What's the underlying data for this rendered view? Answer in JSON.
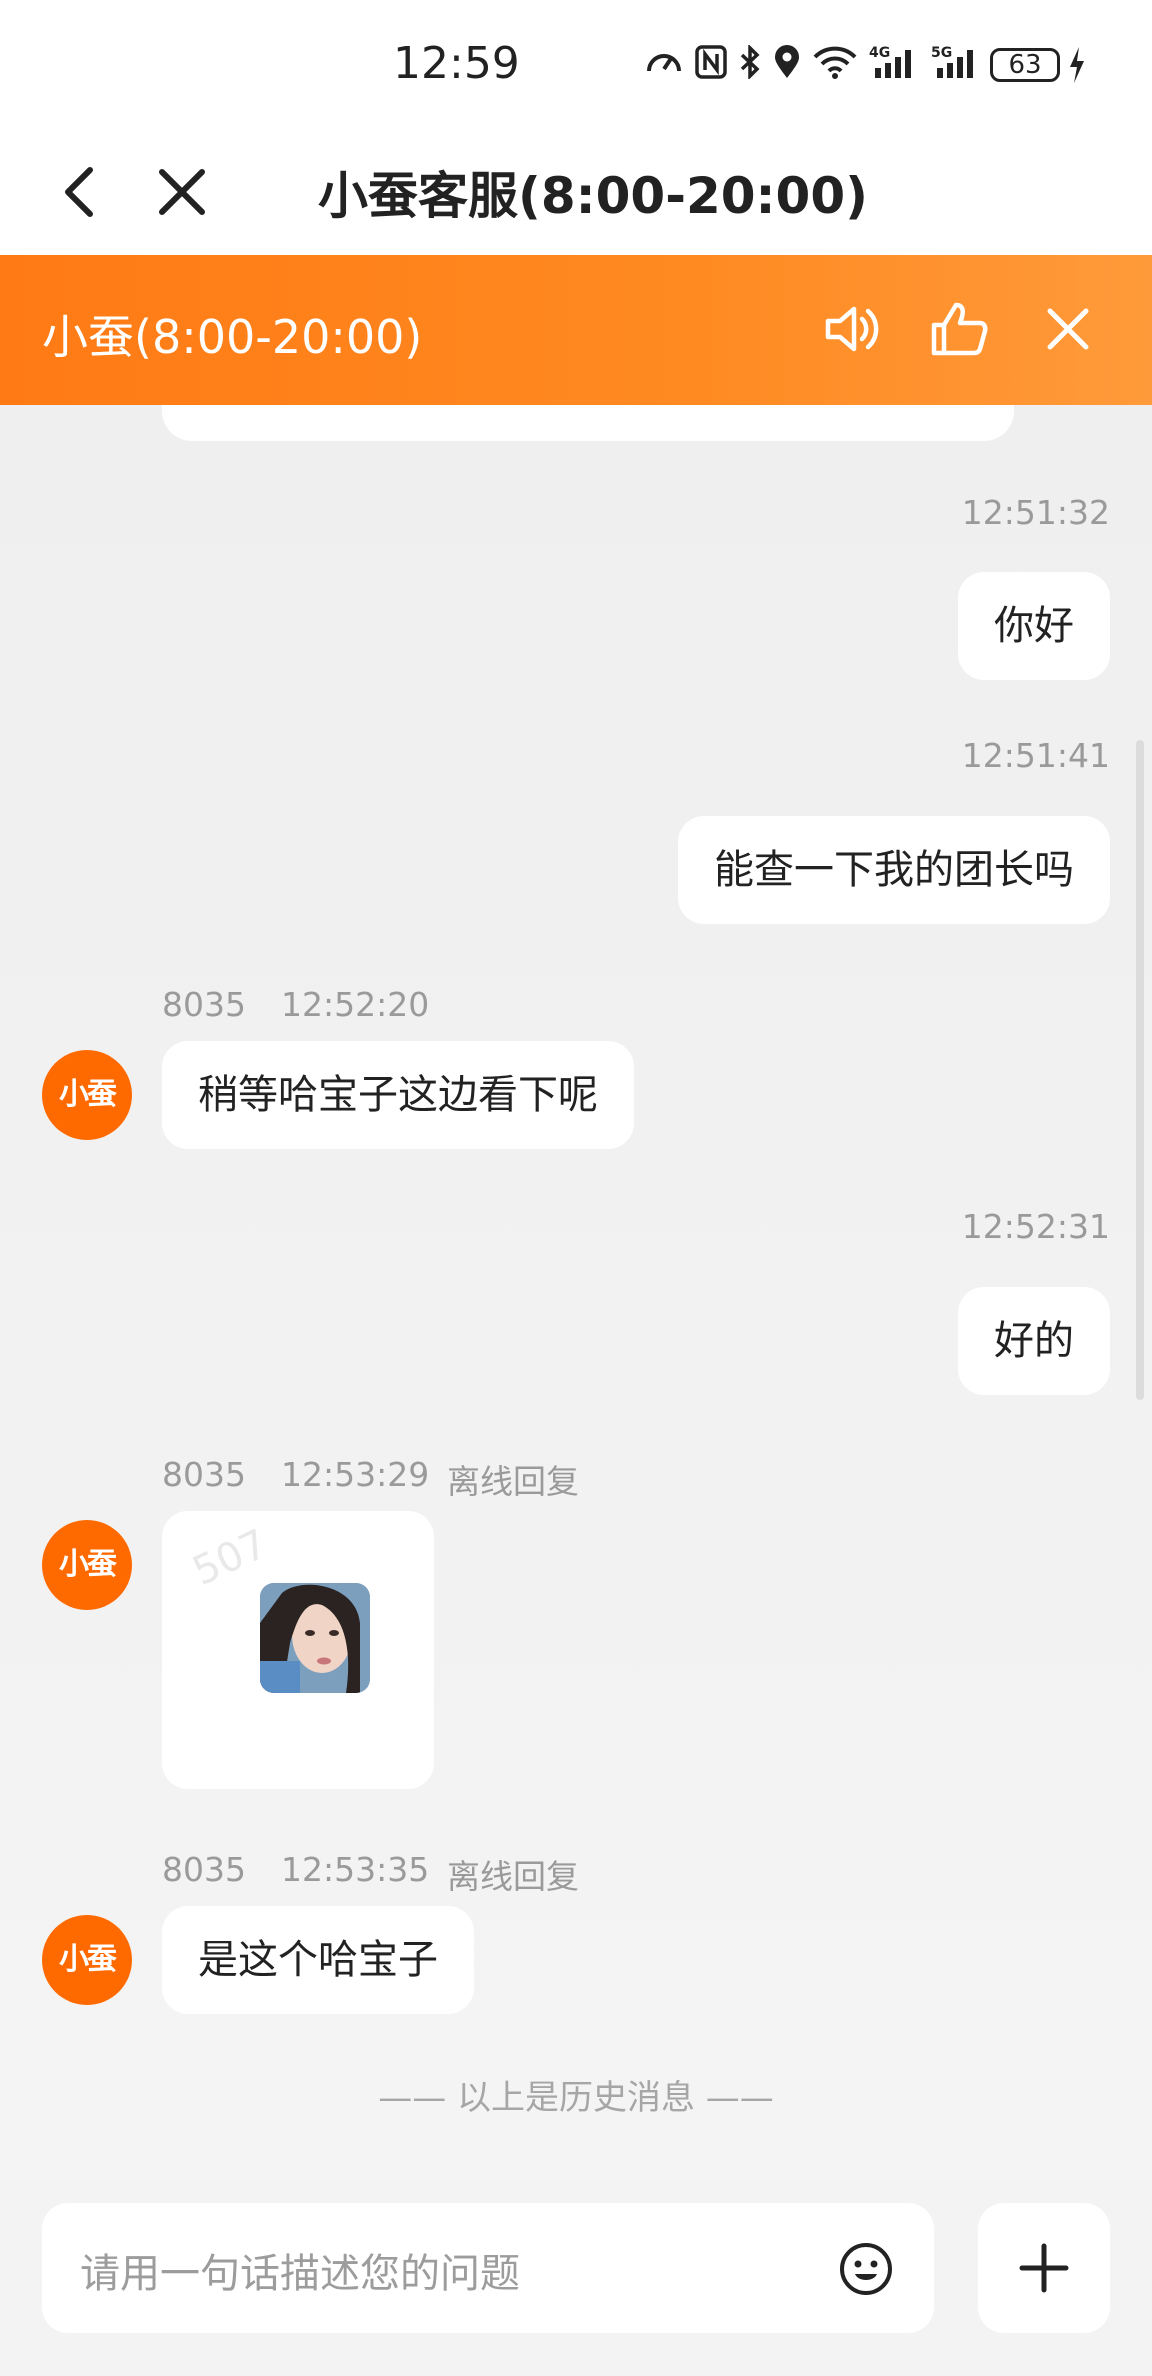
{
  "status_bar": {
    "time": "12:59",
    "battery": "63",
    "network_labels": [
      "4G",
      "5G"
    ]
  },
  "nav": {
    "title": "小蚕客服(8:00-20:00)"
  },
  "agent_bar": {
    "title": "小蚕(8:00-20:00)",
    "accent_color": "#ff7a14"
  },
  "messages": [
    {
      "side": "right",
      "time": "12:51:32",
      "text": "你好"
    },
    {
      "side": "right",
      "time": "12:51:41",
      "text": "能查一下我的团长吗"
    },
    {
      "side": "left",
      "agent_id": "8035",
      "time": "12:52:20",
      "avatar": "小蚕",
      "text": "稍等哈宝子这边看下呢"
    },
    {
      "side": "right",
      "time": "12:52:31",
      "text": "好的"
    },
    {
      "side": "left",
      "agent_id": "8035",
      "time": "12:53:29",
      "tag": "离线回复",
      "avatar": "小蚕",
      "image_watermark": "507"
    },
    {
      "side": "left",
      "agent_id": "8035",
      "time": "12:53:35",
      "tag": "离线回复",
      "avatar": "小蚕",
      "text": "是这个哈宝子"
    }
  ],
  "history_separator": "—— 以上是历史消息 ——",
  "input": {
    "placeholder": "请用一句话描述您的问题"
  }
}
